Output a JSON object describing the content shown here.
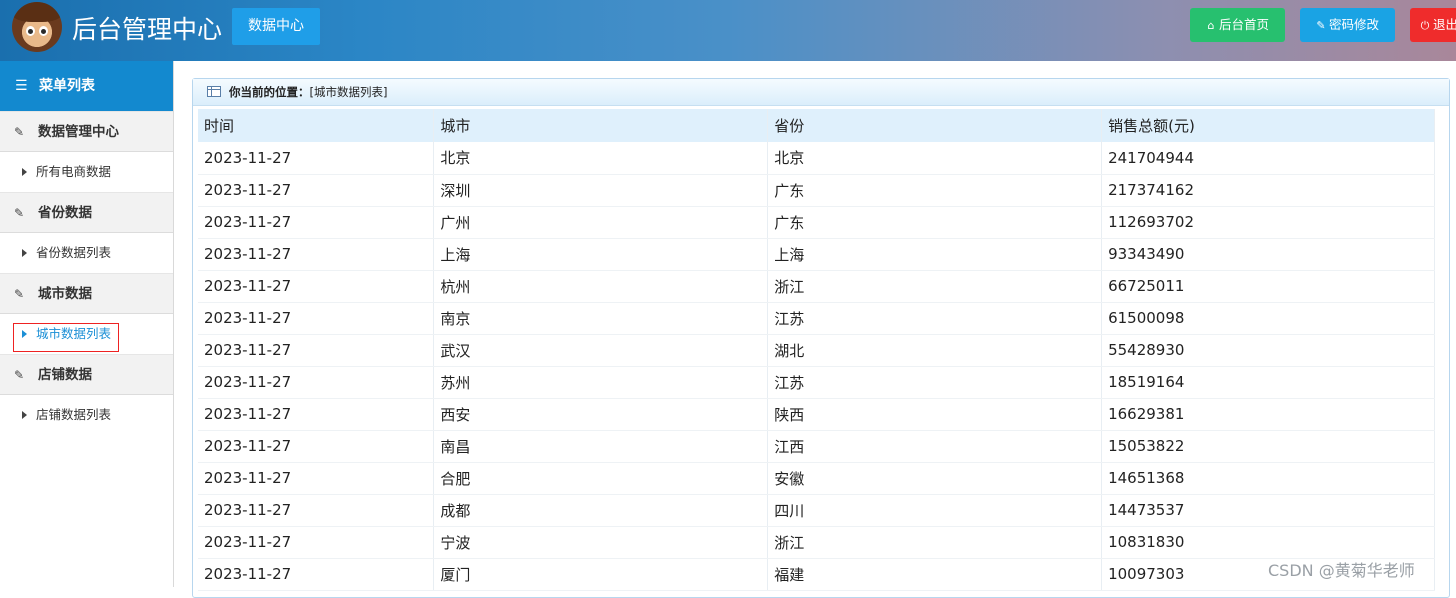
{
  "header": {
    "title": "后台管理中心",
    "data_center": "数据中心",
    "home": "后台首页",
    "home_icon": "home-icon",
    "password": "密码修改",
    "password_icon": "wrench-icon",
    "exit": "退出",
    "exit_icon": "power-icon"
  },
  "sidebar": {
    "title": "菜单列表",
    "groups": [
      {
        "label": "数据管理中心",
        "items": [
          {
            "label": "所有电商数据"
          }
        ]
      },
      {
        "label": "省份数据",
        "items": [
          {
            "label": "省份数据列表"
          }
        ]
      },
      {
        "label": "城市数据",
        "items": [
          {
            "label": "城市数据列表",
            "active": true
          }
        ]
      },
      {
        "label": "店铺数据",
        "items": [
          {
            "label": "店铺数据列表"
          }
        ]
      }
    ]
  },
  "main": {
    "location_label": "你当前的位置：",
    "location_value": "[城市数据列表]",
    "columns": [
      "时间",
      "城市",
      "省份",
      "销售总额(元)"
    ],
    "rows": [
      [
        "2023-11-27",
        "北京",
        "北京",
        "241704944"
      ],
      [
        "2023-11-27",
        "深圳",
        "广东",
        "217374162"
      ],
      [
        "2023-11-27",
        "广州",
        "广东",
        "112693702"
      ],
      [
        "2023-11-27",
        "上海",
        "上海",
        "93343490"
      ],
      [
        "2023-11-27",
        "杭州",
        "浙江",
        "66725011"
      ],
      [
        "2023-11-27",
        "南京",
        "江苏",
        "61500098"
      ],
      [
        "2023-11-27",
        "武汉",
        "湖北",
        "55428930"
      ],
      [
        "2023-11-27",
        "苏州",
        "江苏",
        "18519164"
      ],
      [
        "2023-11-27",
        "西安",
        "陕西",
        "16629381"
      ],
      [
        "2023-11-27",
        "南昌",
        "江西",
        "15053822"
      ],
      [
        "2023-11-27",
        "合肥",
        "安徽",
        "14651368"
      ],
      [
        "2023-11-27",
        "成都",
        "四川",
        "14473537"
      ],
      [
        "2023-11-27",
        "宁波",
        "浙江",
        "10831830"
      ],
      [
        "2023-11-27",
        "厦门",
        "福建",
        "10097303"
      ]
    ]
  },
  "watermark": "CSDN @黄菊华老师",
  "colors": {
    "accent": "#1389cf",
    "home_btn": "#27c06f",
    "pwd_btn": "#1aa3e4",
    "exit_btn": "#ef2c2c"
  }
}
